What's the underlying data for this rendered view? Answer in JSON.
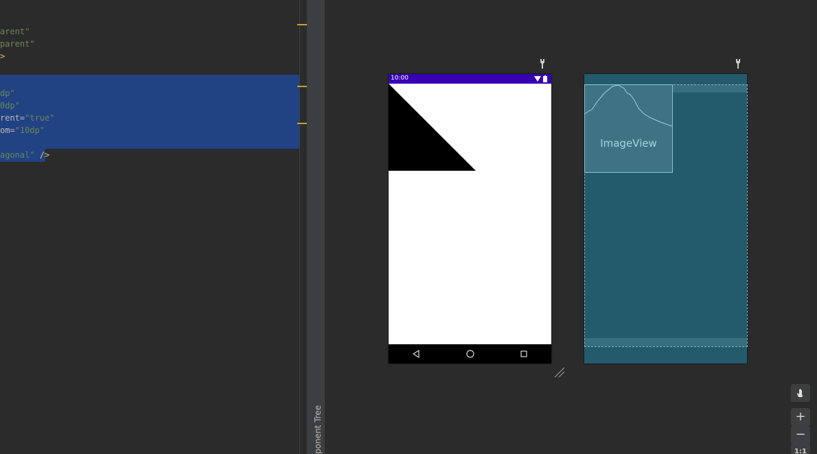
{
  "editor": {
    "lines": [
      {
        "seg1": "",
        "seg2": "arent\"",
        "seg3": ""
      },
      {
        "seg1": "",
        "seg2": "parent\"",
        "seg3": ""
      },
      {
        "seg1": "",
        "seg2": "",
        "seg3": ">"
      },
      {
        "seg1": "",
        "seg2": "dp\"",
        "seg3": ""
      },
      {
        "seg1": "",
        "seg2": "0dp\"",
        "seg3": ""
      },
      {
        "seg1": "rent=",
        "seg2": "\"true\"",
        "seg3": ""
      },
      {
        "seg1": "om=",
        "seg2": "\"10dp\"",
        "seg3": ""
      },
      {
        "seg1": "",
        "seg2": "agonal\"",
        "seg3": " />"
      }
    ]
  },
  "component_tree": {
    "label": "ponent Tree"
  },
  "phone_preview": {
    "status_time": "10:00",
    "statusbar_color": "#3700b3",
    "content": "black-triangle"
  },
  "blueprint": {
    "image_view_label": "ImageView"
  },
  "zoom": {
    "pan": "hand-icon",
    "in": "+",
    "out": "−",
    "fit": "1:1"
  }
}
